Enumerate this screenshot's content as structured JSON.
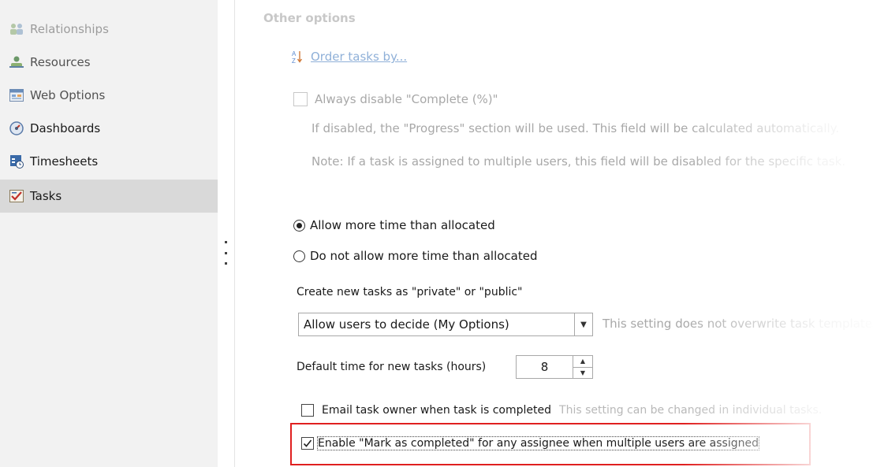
{
  "sidebar": {
    "items": [
      {
        "label": "Relationships",
        "icon": "relationships-icon"
      },
      {
        "label": "Resources",
        "icon": "resources-icon"
      },
      {
        "label": "Web Options",
        "icon": "web-options-icon"
      },
      {
        "label": "Dashboards",
        "icon": "dashboards-icon"
      },
      {
        "label": "Timesheets",
        "icon": "timesheets-icon"
      },
      {
        "label": "Tasks",
        "icon": "tasks-icon"
      }
    ],
    "selected": "Tasks"
  },
  "main": {
    "section_title": "Other options",
    "order_link": "Order tasks by...",
    "always_disable": {
      "label": "Always disable \"Complete (%)\"",
      "checked": false,
      "note1": "If disabled, the \"Progress\" section will be used. This field will be calculated automatically.",
      "note2": "Note: If a task is assigned to multiple users, this field will be disabled for the specific task."
    },
    "time_radio": {
      "options": [
        "Allow more time than allocated",
        "Do not allow more time than allocated"
      ],
      "selected": "Allow more time than allocated"
    },
    "privacy": {
      "label": "Create new tasks as \"private\" or \"public\"",
      "value": "Allow users to decide (My Options)",
      "hint": "This setting does not overwrite task templates."
    },
    "default_time": {
      "label": "Default time for new tasks (hours)",
      "value": "8"
    },
    "email_owner": {
      "label": "Email task owner when task is completed",
      "checked": false,
      "hint": "This setting can be changed in individual tasks."
    },
    "mark_completed": {
      "label": "Enable \"Mark as completed\" for any assignee when multiple users are assigned",
      "checked": true
    }
  },
  "colors": {
    "highlight": "#e02020",
    "link": "#8fb0d8",
    "selected_bg": "#d9d9d9"
  }
}
